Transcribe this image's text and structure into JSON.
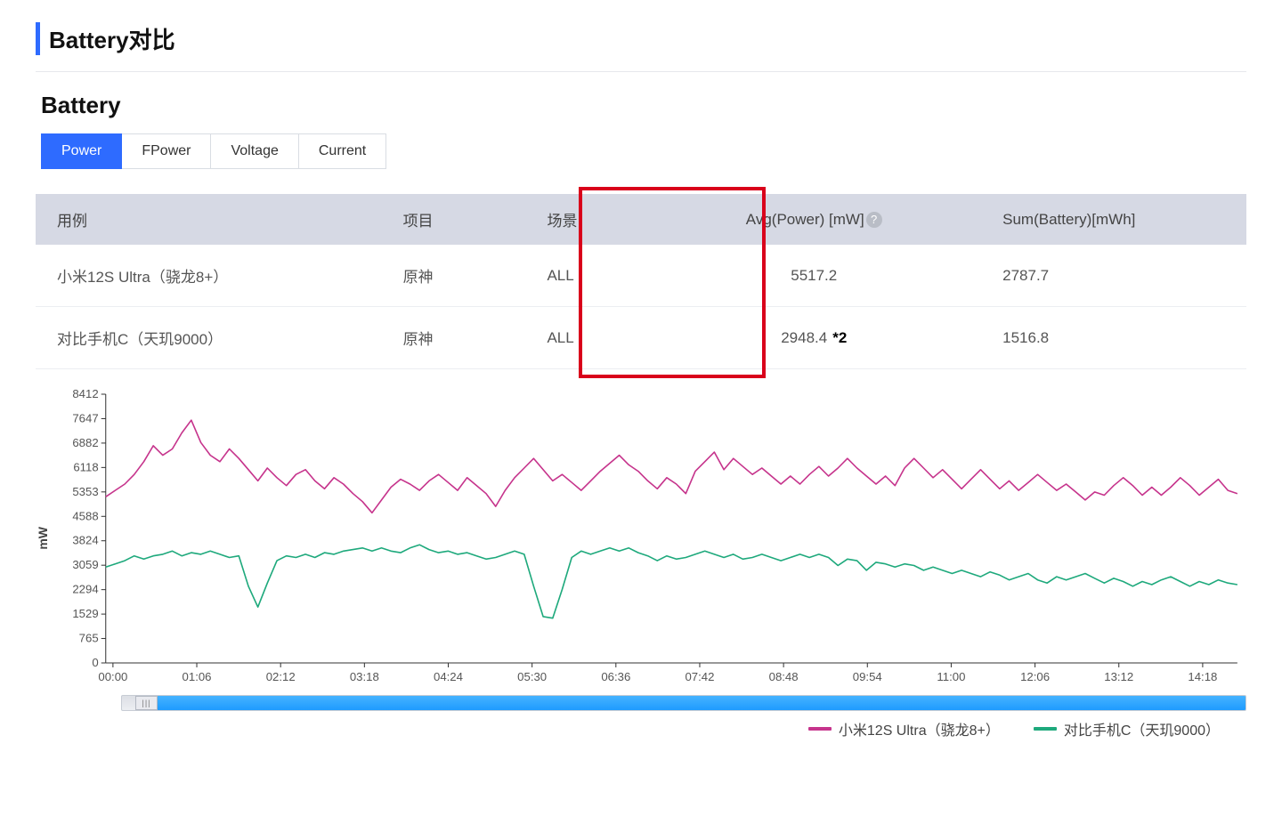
{
  "header": {
    "title": "Battery对比"
  },
  "section": {
    "title": "Battery"
  },
  "tabs": [
    {
      "label": "Power",
      "active": true
    },
    {
      "label": "FPower",
      "active": false
    },
    {
      "label": "Voltage",
      "active": false
    },
    {
      "label": "Current",
      "active": false
    }
  ],
  "table": {
    "headers": [
      "用例",
      "项目",
      "场景",
      "Avg(Power) [mW]",
      "Sum(Battery)[mWh]"
    ],
    "help_icon": "?",
    "rows": [
      {
        "usecase": "小米12S Ultra（骁龙8+）",
        "project": "原神",
        "scene": "ALL",
        "avg_power": "5517.2",
        "sum_batt": "2787.7"
      },
      {
        "usecase": "对比手机C（天玑9000）",
        "project": "原神",
        "scene": "ALL",
        "avg_power": "2948.4",
        "annot": "*2",
        "sum_batt": "1516.8"
      }
    ]
  },
  "chart_data": {
    "type": "line",
    "ylabel": "mW",
    "ylim": [
      0,
      8412
    ],
    "yticks": [
      0,
      765,
      1529,
      2294,
      3059,
      3824,
      4588,
      5353,
      6118,
      6882,
      7647,
      8412
    ],
    "xticks": [
      "00:00",
      "01:06",
      "02:12",
      "03:18",
      "04:24",
      "05:30",
      "06:36",
      "07:42",
      "08:48",
      "09:54",
      "11:00",
      "12:06",
      "13:12",
      "14:18"
    ],
    "colors": {
      "series_a": "#c6348c",
      "series_b": "#1ea97c"
    },
    "legend": [
      {
        "name": "小米12S Ultra（骁龙8+）",
        "color": "#c6348c"
      },
      {
        "name": "对比手机C（天玑9000）",
        "color": "#1ea97c"
      }
    ],
    "series": [
      {
        "name": "小米12S Ultra（骁龙8+）",
        "color": "#c6348c",
        "values": [
          5200,
          5400,
          5600,
          5900,
          6300,
          6800,
          6500,
          6700,
          7200,
          7600,
          6900,
          6500,
          6300,
          6700,
          6400,
          6050,
          5700,
          6100,
          5800,
          5550,
          5900,
          6050,
          5700,
          5450,
          5800,
          5600,
          5300,
          5050,
          4700,
          5100,
          5500,
          5750,
          5600,
          5400,
          5700,
          5900,
          5650,
          5400,
          5800,
          5550,
          5300,
          4900,
          5400,
          5800,
          6100,
          6400,
          6050,
          5700,
          5900,
          5650,
          5400,
          5700,
          6000,
          6250,
          6500,
          6200,
          6000,
          5700,
          5450,
          5800,
          5600,
          5300,
          6000,
          6300,
          6600,
          6050,
          6400,
          6150,
          5900,
          6100,
          5850,
          5600,
          5850,
          5600,
          5900,
          6150,
          5850,
          6100,
          6400,
          6100,
          5850,
          5600,
          5850,
          5550,
          6100,
          6400,
          6100,
          5800,
          6050,
          5750,
          5450,
          5750,
          6050,
          5750,
          5450,
          5700,
          5400,
          5650,
          5900,
          5650,
          5400,
          5600,
          5350,
          5100,
          5350,
          5250,
          5550,
          5800,
          5550,
          5250,
          5500,
          5250,
          5500,
          5800,
          5550,
          5250,
          5500,
          5750,
          5400,
          5300
        ]
      },
      {
        "name": "对比手机C（天玑9000）",
        "color": "#1ea97c",
        "values": [
          3000,
          3100,
          3200,
          3350,
          3250,
          3350,
          3400,
          3500,
          3350,
          3450,
          3400,
          3500,
          3400,
          3300,
          3350,
          2400,
          1750,
          2500,
          3200,
          3350,
          3300,
          3400,
          3300,
          3450,
          3400,
          3500,
          3550,
          3600,
          3500,
          3600,
          3500,
          3450,
          3600,
          3700,
          3550,
          3450,
          3500,
          3400,
          3450,
          3350,
          3250,
          3300,
          3400,
          3500,
          3400,
          2400,
          1450,
          1400,
          2300,
          3300,
          3500,
          3400,
          3500,
          3600,
          3500,
          3600,
          3450,
          3350,
          3200,
          3350,
          3250,
          3300,
          3400,
          3500,
          3400,
          3300,
          3400,
          3250,
          3300,
          3400,
          3300,
          3200,
          3300,
          3400,
          3300,
          3400,
          3300,
          3050,
          3250,
          3200,
          2900,
          3150,
          3100,
          3000,
          3100,
          3050,
          2900,
          3000,
          2900,
          2800,
          2900,
          2800,
          2700,
          2850,
          2750,
          2600,
          2700,
          2800,
          2600,
          2500,
          2700,
          2600,
          2700,
          2800,
          2650,
          2500,
          2650,
          2550,
          2400,
          2550,
          2450,
          2600,
          2700,
          2550,
          2400,
          2550,
          2450,
          2600,
          2500,
          2450
        ]
      }
    ]
  }
}
